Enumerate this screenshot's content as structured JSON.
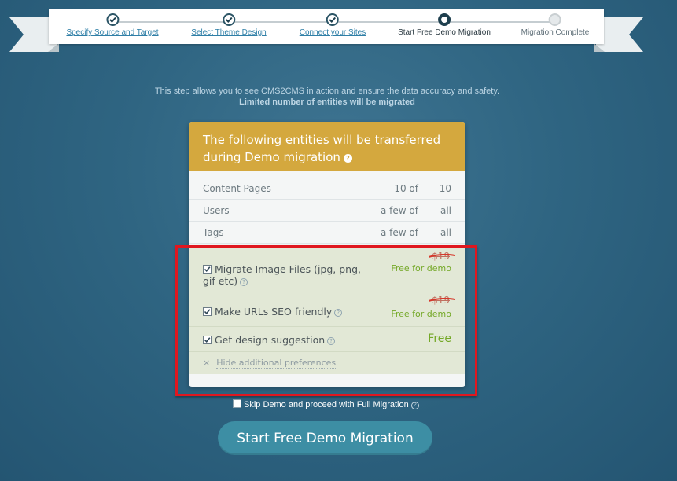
{
  "steps": [
    {
      "label": "Specify Source and Target",
      "state": "done"
    },
    {
      "label": "Select Theme Design",
      "state": "done"
    },
    {
      "label": "Connect your Sites",
      "state": "done"
    },
    {
      "label": "Start Free Demo Migration",
      "state": "current"
    },
    {
      "label": "Migration Complete",
      "state": "future"
    }
  ],
  "intro": {
    "line1": "This step allows you to see CMS2CMS in action and ensure the data accuracy and safety.",
    "line2": "Limited number of entities will be migrated"
  },
  "card": {
    "title": "The following entities will be transferred during Demo migration",
    "help_glyph": "?",
    "entities": [
      {
        "name": "Content Pages",
        "count": "10 of",
        "total": "10"
      },
      {
        "name": "Users",
        "count": "a few of",
        "total": "all"
      },
      {
        "name": "Tags",
        "count": "a few of",
        "total": "all"
      }
    ],
    "preferences": [
      {
        "label": "Migrate Image Files (jpg, png, gif etc)",
        "old_price": "$19",
        "price": "Free for demo",
        "checked": true
      },
      {
        "label": "Make URLs SEO friendly",
        "old_price": "$19",
        "price": "Free for demo",
        "checked": true
      },
      {
        "label": "Get design suggestion",
        "price": "Free",
        "checked": true
      }
    ],
    "hide_glyph": "×",
    "hide_label": "Hide additional preferences"
  },
  "skip": {
    "label": "Skip Demo and proceed with Full Migration",
    "checked": false
  },
  "cta_label": "Start Free Demo Migration",
  "colors": {
    "accent": "#d4a83e",
    "cta": "#3d8ea4",
    "free": "#74a827",
    "highlight": "#e0171f"
  }
}
